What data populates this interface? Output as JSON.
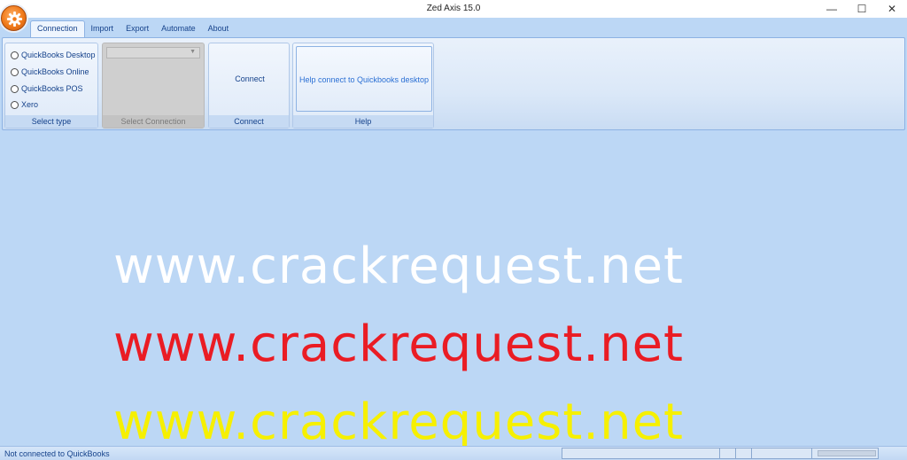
{
  "window": {
    "title": "Zed Axis 15.0",
    "minimize": "—",
    "maximize": "☐",
    "close": "✕"
  },
  "tabs": [
    {
      "label": "Connection",
      "active": true
    },
    {
      "label": "Import"
    },
    {
      "label": "Export"
    },
    {
      "label": "Automate"
    },
    {
      "label": "About"
    }
  ],
  "ribbon": {
    "select_type": {
      "label": "Select type",
      "options": [
        "QuickBooks Desktop",
        "QuickBooks Online",
        "QuickBooks POS",
        "Xero"
      ]
    },
    "select_connection": {
      "label": "Select Connection",
      "value": "",
      "arrow": "▼"
    },
    "connect": {
      "label": "Connect",
      "button": "Connect"
    },
    "help": {
      "label": "Help",
      "button": "Help connect to Quickbooks desktop"
    }
  },
  "watermark": [
    "www.crackrequest.net",
    "www.crackrequest.net",
    "www.crackrequest.net"
  ],
  "status": {
    "text": "Not connected to QuickBooks"
  },
  "icons": {
    "app_orb": "gear-icon"
  },
  "colors": {
    "accent": "#15428b",
    "orb": "#f07a1a",
    "background": "#bcd7f5"
  }
}
